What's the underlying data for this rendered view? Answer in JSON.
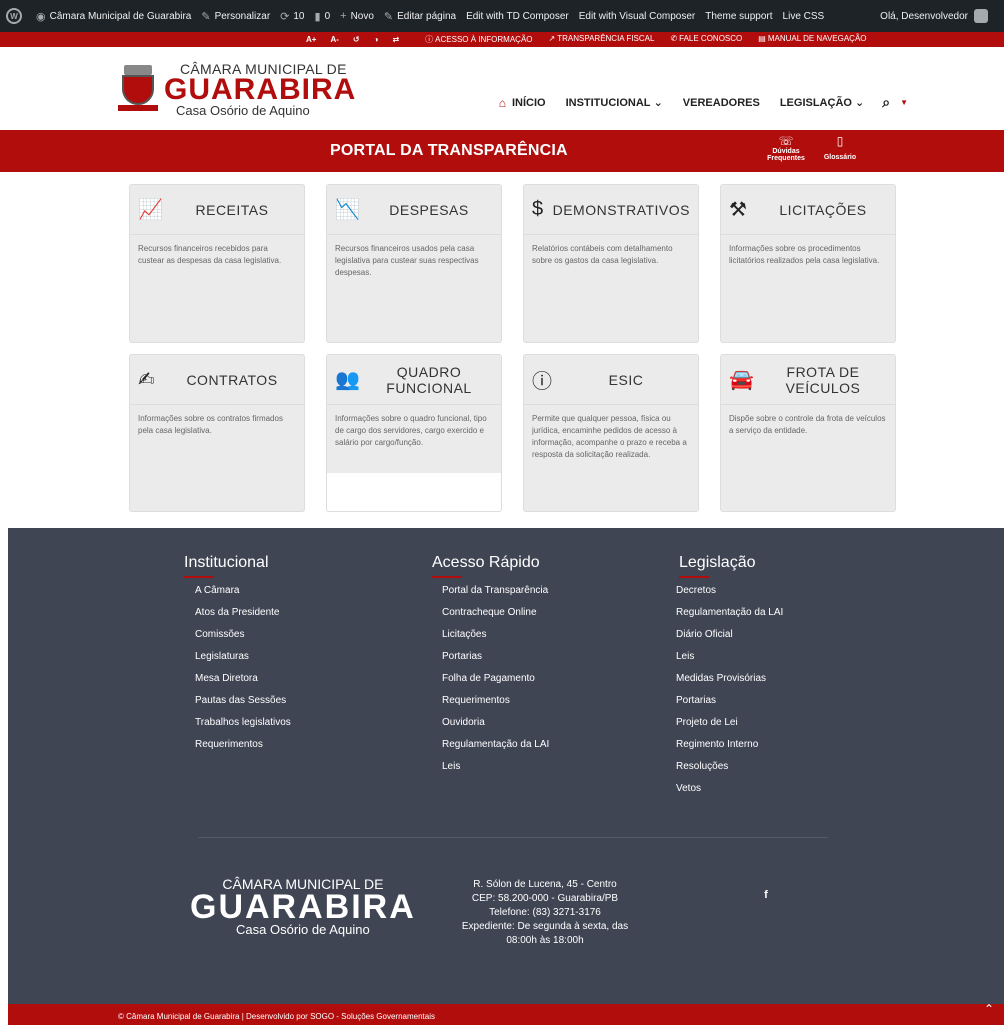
{
  "adminbar": {
    "site_name": "Câmara Municipal de Guarabira",
    "customize": "Personalizar",
    "updates": "10",
    "comments": "0",
    "new": "Novo",
    "edit_page": "Editar página",
    "td_composer": "Edit with TD Composer",
    "visual_composer": "Edit with Visual Composer",
    "theme_support": "Theme support",
    "live_css": "Live CSS",
    "greeting": "Olá, Desenvolvedor"
  },
  "accessibility": {
    "font_increase": "A+",
    "font_decrease": "A-",
    "links": [
      {
        "label": "ACESSO À INFORMAÇÃO",
        "icon": "info-icon"
      },
      {
        "label": "TRANSPARÊNCIA FISCAL",
        "icon": "chart-icon"
      },
      {
        "label": "FALE CONOSCO",
        "icon": "phone-icon"
      },
      {
        "label": "MANUAL DE NAVEGAÇÃO",
        "icon": "document-icon"
      }
    ]
  },
  "logo": {
    "line1": "CÂMARA MUNICIPAL DE",
    "line2": "GUARABIRA",
    "line3": "Casa Osório de Aquino"
  },
  "nav": {
    "home": "INÍCIO",
    "institucional": "INSTITUCIONAL",
    "vereadores": "VEREADORES",
    "legislacao": "LEGISLAÇÃO"
  },
  "portal": {
    "title": "PORTAL DA TRANSPARÊNCIA",
    "faq": "Dúvidas Frequentes",
    "glossary": "Glossário"
  },
  "cards": [
    {
      "title": "RECEITAS",
      "icon": "chart-up-icon",
      "text": "Recursos financeiros recebidos para custear as despesas da casa legislativa."
    },
    {
      "title": "DESPESAS",
      "icon": "chart-down-icon",
      "text": "Recursos financeiros usados pela casa legislativa para custear suas respectivas despesas."
    },
    {
      "title": "DEMONSTRATIVOS",
      "icon": "dollar-icon",
      "text": "Relatórios contábeis com detalhamento sobre os gastos da casa legislativa."
    },
    {
      "title": "LICITAÇÕES",
      "icon": "gavel-icon",
      "text": "Informações sobre os procedimentos licitatórios realizados pela casa legislativa."
    },
    {
      "title": "CONTRATOS",
      "icon": "contract-icon",
      "text": "Informações sobre os contratos firmados pela casa legislativa."
    },
    {
      "title": "QUADRO FUNCIONAL",
      "icon": "users-icon",
      "text": "Informações sobre o quadro funcional, tipo de cargo dos servidores, cargo exercido e salário por cargo/função."
    },
    {
      "title": "ESIC",
      "icon": "info-circle-icon",
      "text": "Permite que qualquer pessoa, física ou jurídica, encaminhe pedidos de acesso à informação, acompanhe o prazo e receba a resposta da solicitação realizada."
    },
    {
      "title": "FROTA DE VEÍCULOS",
      "icon": "car-icon",
      "text": "Dispõe sobre o controle da frota de veículos a serviço da entidade."
    }
  ],
  "footer": {
    "institucional": {
      "title": "Institucional",
      "items": [
        "A Câmara",
        "Atos da Presidente",
        "Comissões",
        "Legislaturas",
        "Mesa Diretora",
        "Pautas das Sessões",
        "Trabalhos legislativos",
        "Requerimentos"
      ]
    },
    "acesso": {
      "title": "Acesso Rápido",
      "items": [
        "Portal da Transparência",
        "Contracheque Online",
        "Licitações",
        "Portarias",
        "Folha de Pagamento",
        "Requerimentos",
        "Ouvidoria",
        "Regulamentação da LAI",
        "Leis"
      ]
    },
    "legislacao": {
      "title": "Legislação",
      "items": [
        "Decretos",
        "Regulamentação da LAI",
        "Diário Oficial",
        "Leis",
        "Medidas Provisórias",
        "Portarias",
        "Projeto de Lei",
        "Regimento Interno",
        "Resoluções",
        "Vetos"
      ]
    },
    "logo_line1": "CÂMARA MUNICIPAL DE",
    "logo_line2": "GUARABIRA",
    "logo_line3": "Casa Osório de Aquino",
    "address": [
      "R. Sólon de Lucena, 45 - Centro",
      "CEP: 58.200-000 - Guarabira/PB",
      "Telefone: (83) 3271-3176",
      "Expediente: De segunda à sexta, das 08:00h às 18:00h"
    ],
    "facebook": "f",
    "copyright": "© Câmara Municipal de Guarabira | Desenvolvido por SOGO - Soluções Governamentais"
  },
  "colors": {
    "brand_red": "#b10d0d",
    "footer_bg": "#404554",
    "admin_bg": "#1d2327"
  }
}
